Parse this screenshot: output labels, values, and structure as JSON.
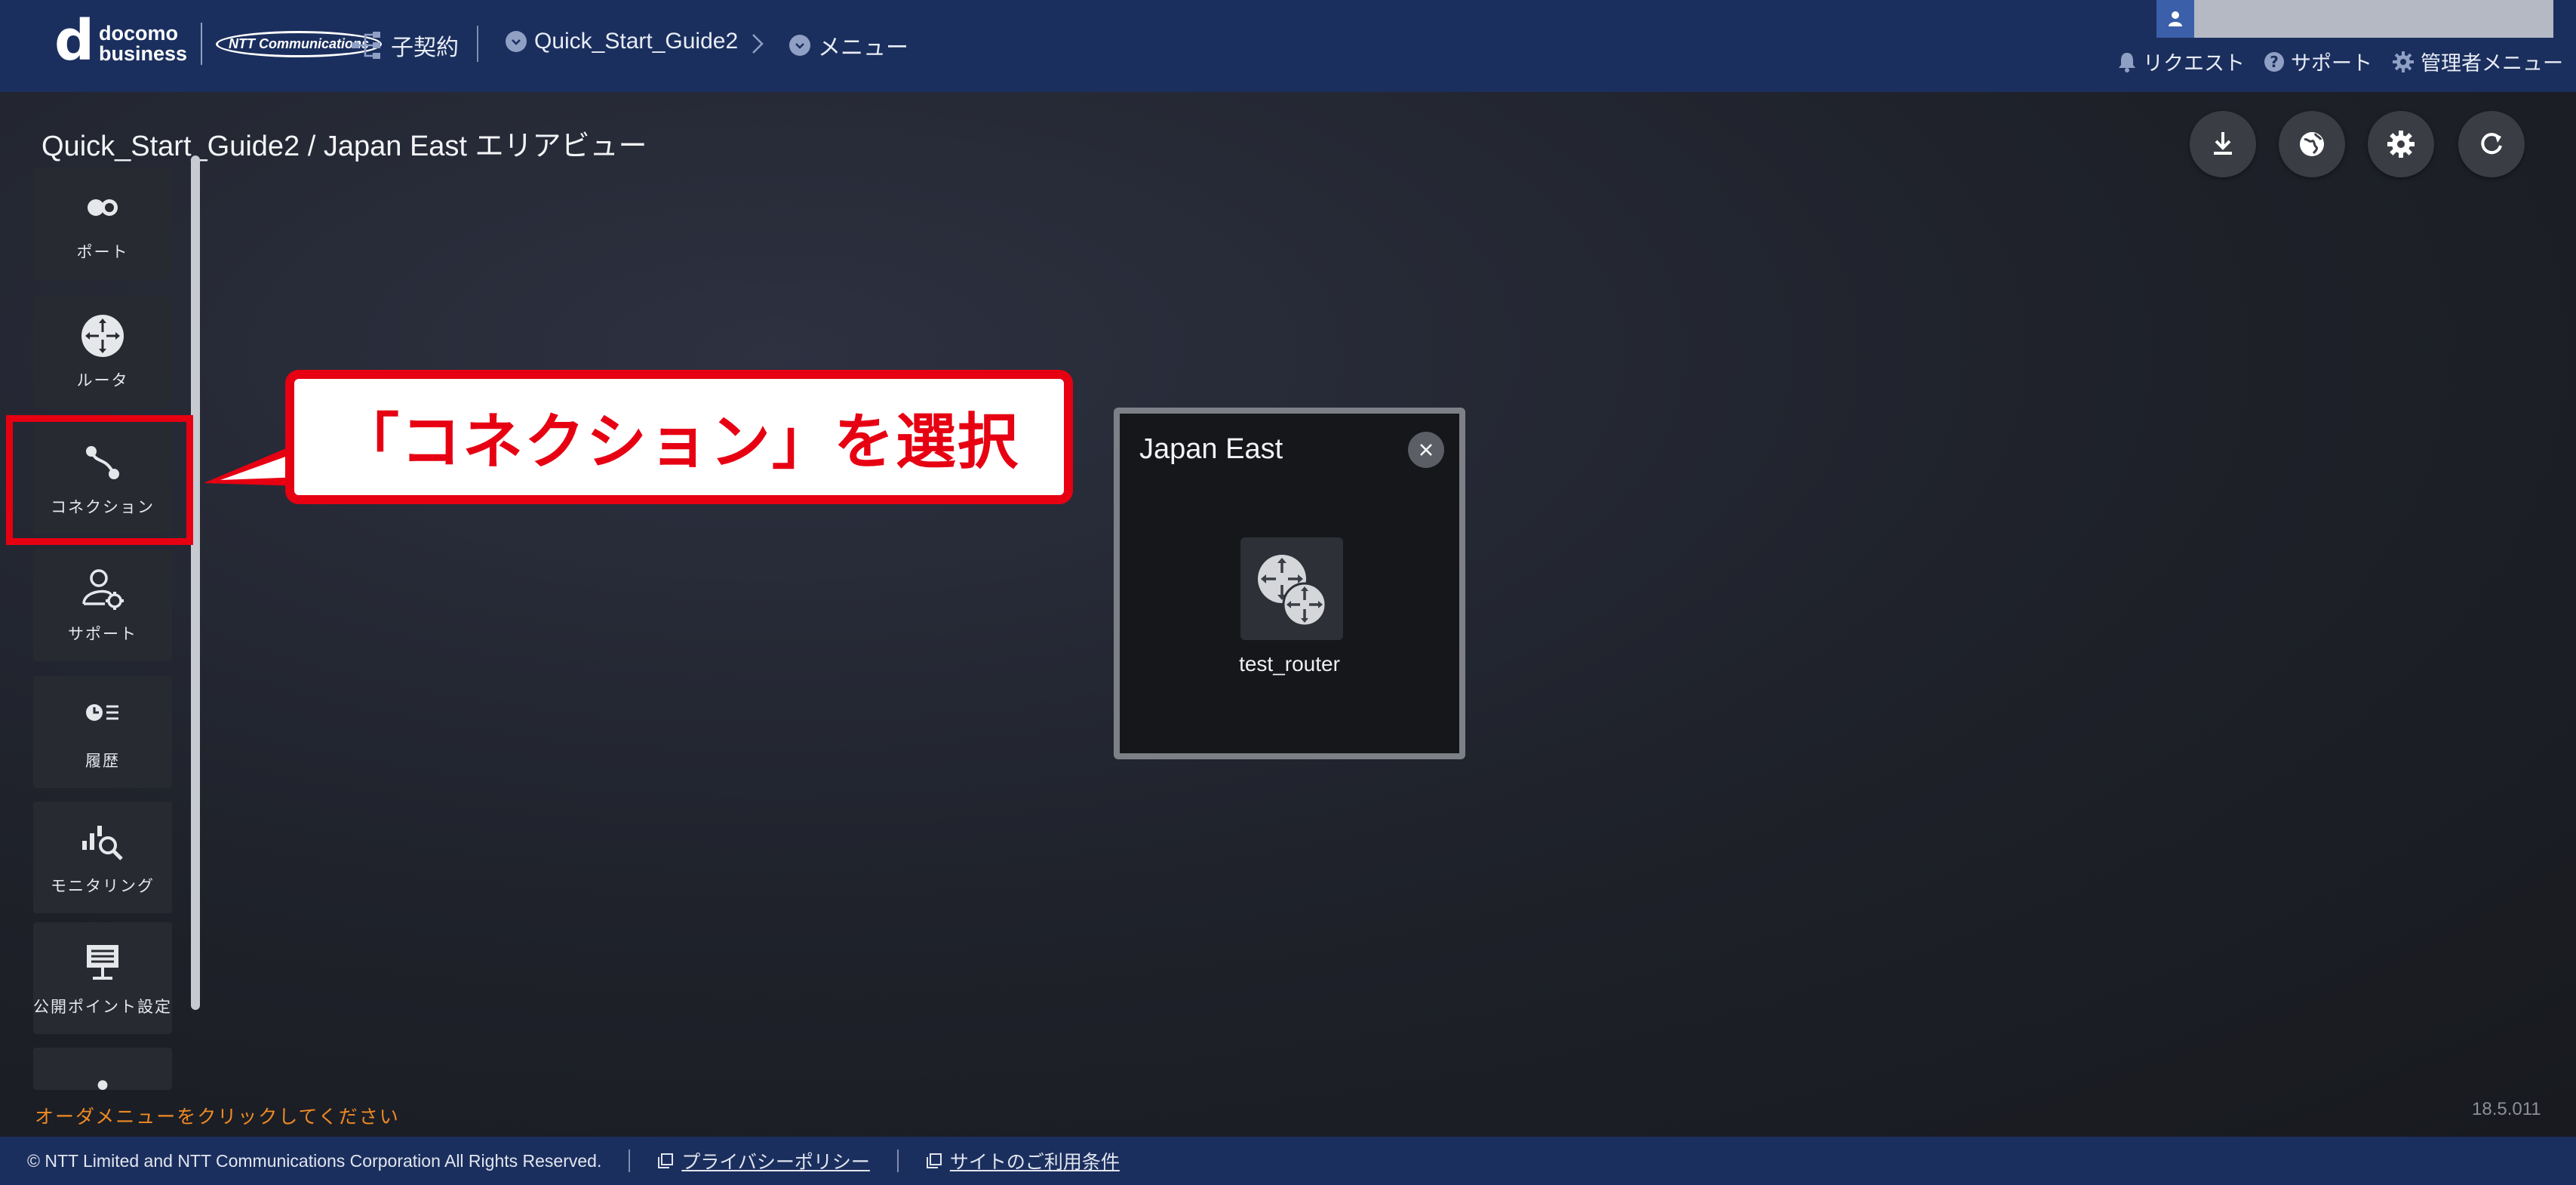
{
  "header": {
    "logo_line1": "docomo",
    "logo_line2": "business",
    "logo_ntt": "NTT Communications",
    "sub_contract": "子契約",
    "breadcrumb_project": "Quick_Start_Guide2",
    "breadcrumb_menu": "メニュー",
    "request": "リクエスト",
    "support": "サポート",
    "admin_menu": "管理者メニュー"
  },
  "page": {
    "title": "Quick_Start_Guide2 / Japan East エリアビュー"
  },
  "sidebar": {
    "items": [
      {
        "label": "ポート",
        "icon": "port-icon"
      },
      {
        "label": "ルータ",
        "icon": "router-icon"
      },
      {
        "label": "コネクション",
        "icon": "connection-icon"
      },
      {
        "label": "サポート",
        "icon": "support-icon"
      },
      {
        "label": "履歴",
        "icon": "history-icon"
      },
      {
        "label": "モニタリング",
        "icon": "monitoring-icon"
      },
      {
        "label": "公開ポイント設定",
        "icon": "public-point-icon"
      }
    ]
  },
  "callout": {
    "text": "「コネクション」を選択"
  },
  "area_panel": {
    "title": "Japan East",
    "router_name": "test_router"
  },
  "status": {
    "order_hint": "オーダメニューをクリックしてください",
    "version": "18.5.011"
  },
  "footer": {
    "copyright": "© NTT Limited and NTT Communications Corporation All Rights Reserved.",
    "privacy": "プライバシーポリシー",
    "terms": "サイトのご利用条件"
  },
  "colors": {
    "header_bg": "#1b2f5e",
    "accent_red": "#e60012",
    "hint_orange": "#f08a24"
  }
}
